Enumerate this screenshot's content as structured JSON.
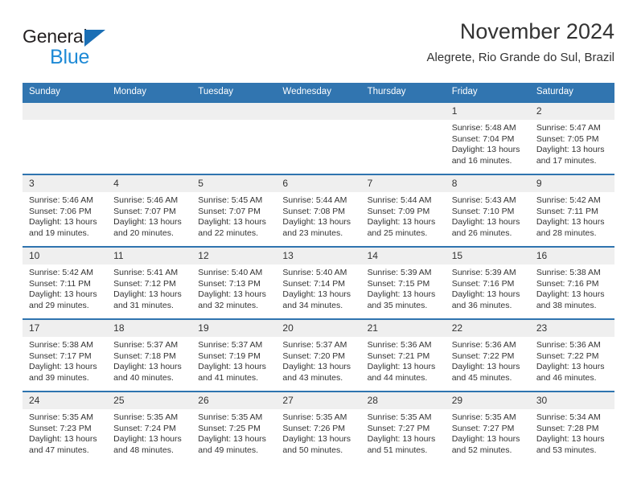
{
  "brand": {
    "name_top": "General",
    "name_bottom": "Blue",
    "triangle_color": "#1b6fb5",
    "blue_text_color": "#1e8ad6"
  },
  "header": {
    "title": "November 2024",
    "subtitle": "Alegrete, Rio Grande do Sul, Brazil"
  },
  "theme": {
    "header_blue": "#3175b0",
    "row_rule_blue": "#2f74af",
    "daynum_band": "#efefef",
    "text": "#333333"
  },
  "calendar": {
    "day_headers": [
      "Sunday",
      "Monday",
      "Tuesday",
      "Wednesday",
      "Thursday",
      "Friday",
      "Saturday"
    ],
    "weeks": [
      [
        {
          "day": "",
          "empty": true,
          "sunrise": "",
          "sunset": "",
          "daylight": ""
        },
        {
          "day": "",
          "empty": true,
          "sunrise": "",
          "sunset": "",
          "daylight": ""
        },
        {
          "day": "",
          "empty": true,
          "sunrise": "",
          "sunset": "",
          "daylight": ""
        },
        {
          "day": "",
          "empty": true,
          "sunrise": "",
          "sunset": "",
          "daylight": ""
        },
        {
          "day": "",
          "empty": true,
          "sunrise": "",
          "sunset": "",
          "daylight": ""
        },
        {
          "day": "1",
          "sunrise": "Sunrise: 5:48 AM",
          "sunset": "Sunset: 7:04 PM",
          "daylight": "Daylight: 13 hours and 16 minutes."
        },
        {
          "day": "2",
          "sunrise": "Sunrise: 5:47 AM",
          "sunset": "Sunset: 7:05 PM",
          "daylight": "Daylight: 13 hours and 17 minutes."
        }
      ],
      [
        {
          "day": "3",
          "sunrise": "Sunrise: 5:46 AM",
          "sunset": "Sunset: 7:06 PM",
          "daylight": "Daylight: 13 hours and 19 minutes."
        },
        {
          "day": "4",
          "sunrise": "Sunrise: 5:46 AM",
          "sunset": "Sunset: 7:07 PM",
          "daylight": "Daylight: 13 hours and 20 minutes."
        },
        {
          "day": "5",
          "sunrise": "Sunrise: 5:45 AM",
          "sunset": "Sunset: 7:07 PM",
          "daylight": "Daylight: 13 hours and 22 minutes."
        },
        {
          "day": "6",
          "sunrise": "Sunrise: 5:44 AM",
          "sunset": "Sunset: 7:08 PM",
          "daylight": "Daylight: 13 hours and 23 minutes."
        },
        {
          "day": "7",
          "sunrise": "Sunrise: 5:44 AM",
          "sunset": "Sunset: 7:09 PM",
          "daylight": "Daylight: 13 hours and 25 minutes."
        },
        {
          "day": "8",
          "sunrise": "Sunrise: 5:43 AM",
          "sunset": "Sunset: 7:10 PM",
          "daylight": "Daylight: 13 hours and 26 minutes."
        },
        {
          "day": "9",
          "sunrise": "Sunrise: 5:42 AM",
          "sunset": "Sunset: 7:11 PM",
          "daylight": "Daylight: 13 hours and 28 minutes."
        }
      ],
      [
        {
          "day": "10",
          "sunrise": "Sunrise: 5:42 AM",
          "sunset": "Sunset: 7:11 PM",
          "daylight": "Daylight: 13 hours and 29 minutes."
        },
        {
          "day": "11",
          "sunrise": "Sunrise: 5:41 AM",
          "sunset": "Sunset: 7:12 PM",
          "daylight": "Daylight: 13 hours and 31 minutes."
        },
        {
          "day": "12",
          "sunrise": "Sunrise: 5:40 AM",
          "sunset": "Sunset: 7:13 PM",
          "daylight": "Daylight: 13 hours and 32 minutes."
        },
        {
          "day": "13",
          "sunrise": "Sunrise: 5:40 AM",
          "sunset": "Sunset: 7:14 PM",
          "daylight": "Daylight: 13 hours and 34 minutes."
        },
        {
          "day": "14",
          "sunrise": "Sunrise: 5:39 AM",
          "sunset": "Sunset: 7:15 PM",
          "daylight": "Daylight: 13 hours and 35 minutes."
        },
        {
          "day": "15",
          "sunrise": "Sunrise: 5:39 AM",
          "sunset": "Sunset: 7:16 PM",
          "daylight": "Daylight: 13 hours and 36 minutes."
        },
        {
          "day": "16",
          "sunrise": "Sunrise: 5:38 AM",
          "sunset": "Sunset: 7:16 PM",
          "daylight": "Daylight: 13 hours and 38 minutes."
        }
      ],
      [
        {
          "day": "17",
          "sunrise": "Sunrise: 5:38 AM",
          "sunset": "Sunset: 7:17 PM",
          "daylight": "Daylight: 13 hours and 39 minutes."
        },
        {
          "day": "18",
          "sunrise": "Sunrise: 5:37 AM",
          "sunset": "Sunset: 7:18 PM",
          "daylight": "Daylight: 13 hours and 40 minutes."
        },
        {
          "day": "19",
          "sunrise": "Sunrise: 5:37 AM",
          "sunset": "Sunset: 7:19 PM",
          "daylight": "Daylight: 13 hours and 41 minutes."
        },
        {
          "day": "20",
          "sunrise": "Sunrise: 5:37 AM",
          "sunset": "Sunset: 7:20 PM",
          "daylight": "Daylight: 13 hours and 43 minutes."
        },
        {
          "day": "21",
          "sunrise": "Sunrise: 5:36 AM",
          "sunset": "Sunset: 7:21 PM",
          "daylight": "Daylight: 13 hours and 44 minutes."
        },
        {
          "day": "22",
          "sunrise": "Sunrise: 5:36 AM",
          "sunset": "Sunset: 7:22 PM",
          "daylight": "Daylight: 13 hours and 45 minutes."
        },
        {
          "day": "23",
          "sunrise": "Sunrise: 5:36 AM",
          "sunset": "Sunset: 7:22 PM",
          "daylight": "Daylight: 13 hours and 46 minutes."
        }
      ],
      [
        {
          "day": "24",
          "sunrise": "Sunrise: 5:35 AM",
          "sunset": "Sunset: 7:23 PM",
          "daylight": "Daylight: 13 hours and 47 minutes."
        },
        {
          "day": "25",
          "sunrise": "Sunrise: 5:35 AM",
          "sunset": "Sunset: 7:24 PM",
          "daylight": "Daylight: 13 hours and 48 minutes."
        },
        {
          "day": "26",
          "sunrise": "Sunrise: 5:35 AM",
          "sunset": "Sunset: 7:25 PM",
          "daylight": "Daylight: 13 hours and 49 minutes."
        },
        {
          "day": "27",
          "sunrise": "Sunrise: 5:35 AM",
          "sunset": "Sunset: 7:26 PM",
          "daylight": "Daylight: 13 hours and 50 minutes."
        },
        {
          "day": "28",
          "sunrise": "Sunrise: 5:35 AM",
          "sunset": "Sunset: 7:27 PM",
          "daylight": "Daylight: 13 hours and 51 minutes."
        },
        {
          "day": "29",
          "sunrise": "Sunrise: 5:35 AM",
          "sunset": "Sunset: 7:27 PM",
          "daylight": "Daylight: 13 hours and 52 minutes."
        },
        {
          "day": "30",
          "sunrise": "Sunrise: 5:34 AM",
          "sunset": "Sunset: 7:28 PM",
          "daylight": "Daylight: 13 hours and 53 minutes."
        }
      ]
    ]
  }
}
